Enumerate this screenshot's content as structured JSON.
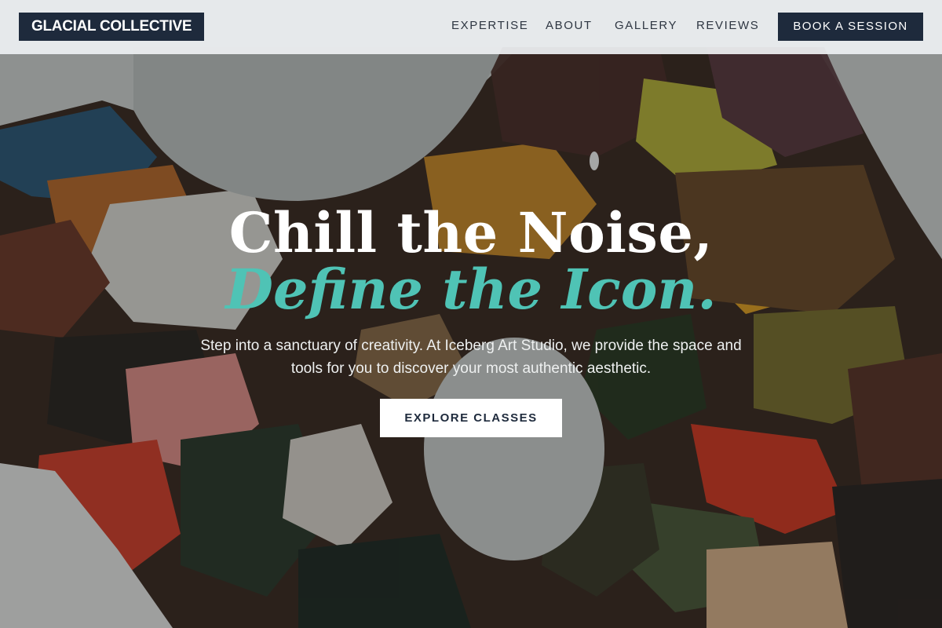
{
  "header": {
    "brand": "GLACIAL COLLECTIVE",
    "nav": [
      {
        "label": "EXPERTISE"
      },
      {
        "label": "ABOUT"
      },
      {
        "label": "GALLERY"
      },
      {
        "label": "REVIEWS"
      }
    ],
    "cta_label": "BOOK A SESSION"
  },
  "hero": {
    "headline_line1": "Chill the Noise,",
    "headline_line2": "Define the Icon.",
    "lead": "Step into a sanctuary of creativity. At Iceberg Art Studio, we provide the space and tools for you to discover your most authentic aesthetic.",
    "button_label": "EXPLORE CLASSES"
  },
  "colors": {
    "header_bg": "#eceef0",
    "navy": "#1e2a3c",
    "accent_teal": "#4fc3b5",
    "white": "#ffffff"
  }
}
